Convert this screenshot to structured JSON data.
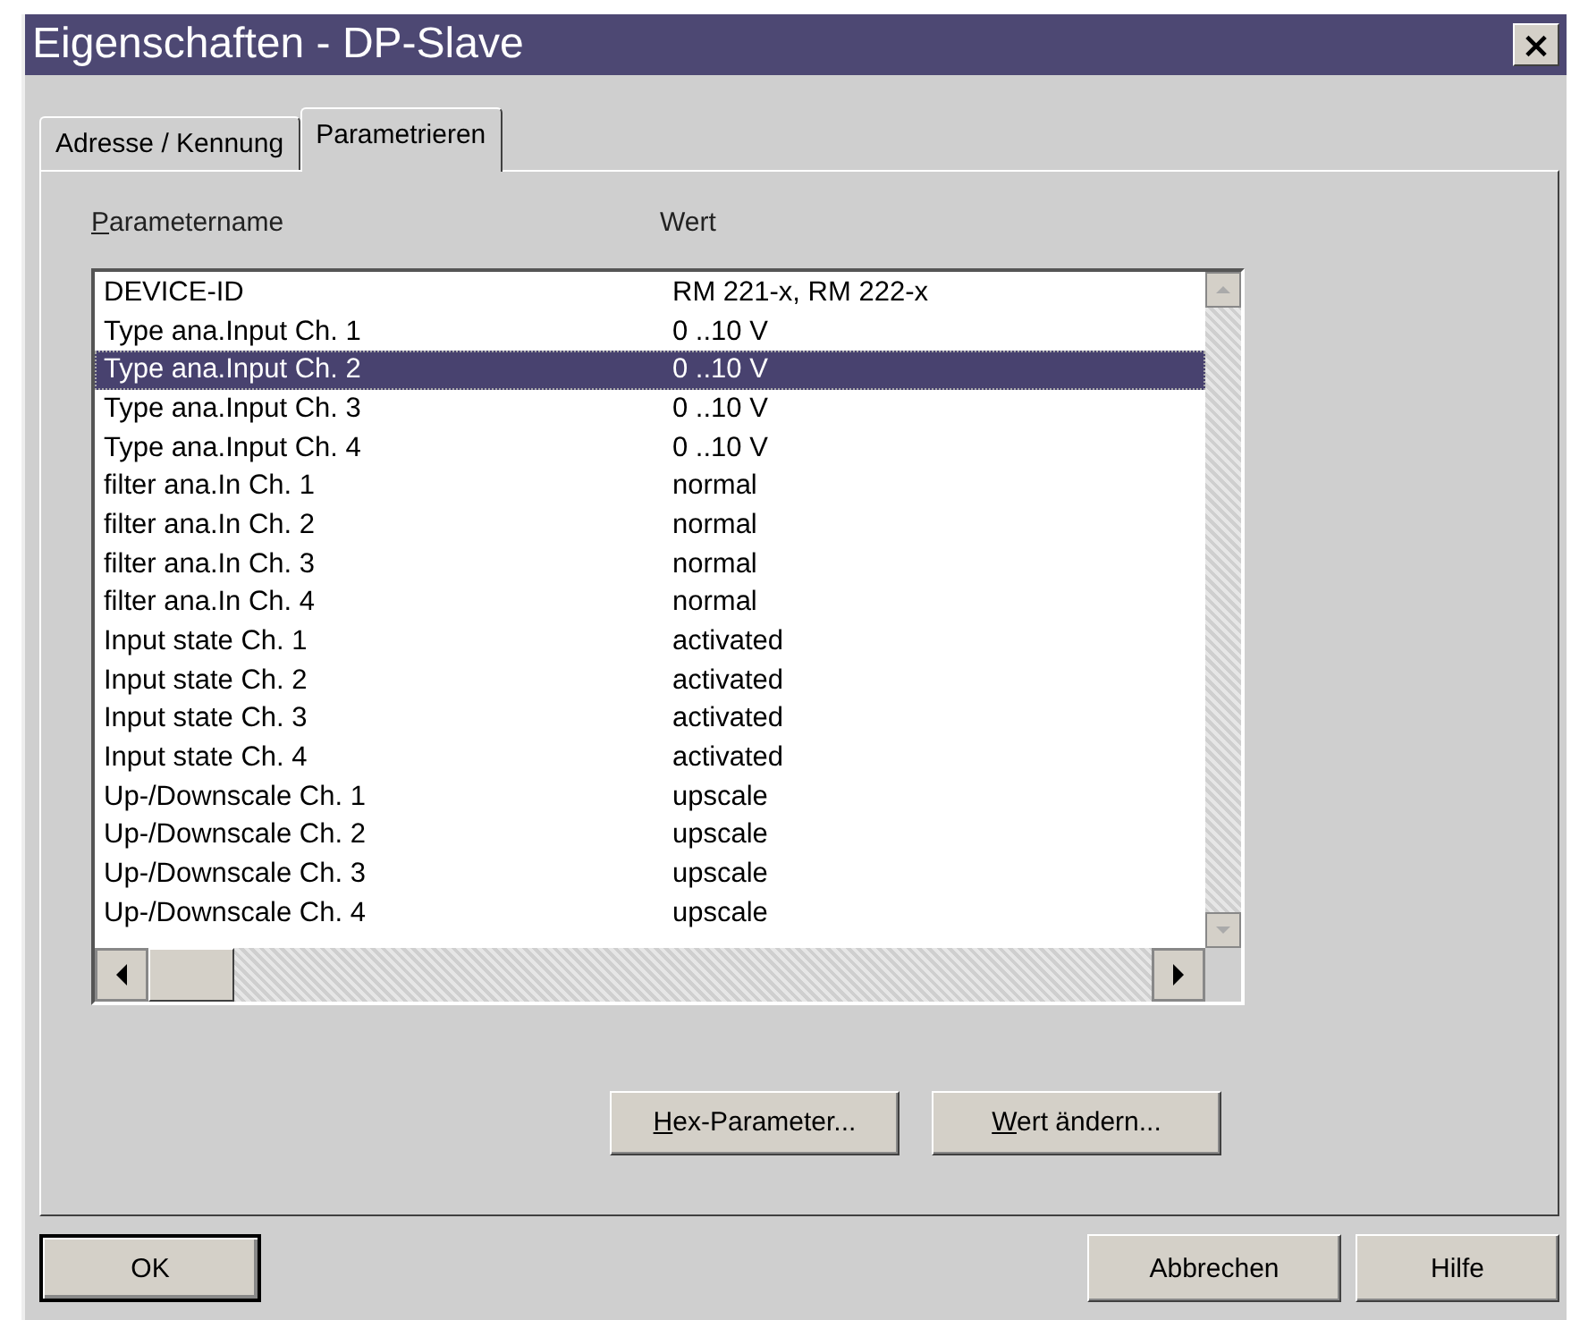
{
  "window": {
    "title": "Eigenschaften - DP-Slave",
    "close": "×"
  },
  "tabs": [
    {
      "label": "Adresse / Kennung",
      "selected": false
    },
    {
      "label": "Parametrieren",
      "selected": true
    }
  ],
  "list": {
    "columns": [
      "Parametername",
      "Wert"
    ],
    "rows": [
      {
        "name": "DEVICE-ID",
        "value": "RM 221-x, RM 222-x",
        "selected": false
      },
      {
        "name": "Type ana.Input Ch. 1",
        "value": "0 ..10 V",
        "selected": false
      },
      {
        "name": "Type ana.Input Ch. 2",
        "value": "0 ..10 V",
        "selected": true
      },
      {
        "name": "Type ana.Input Ch. 3",
        "value": "0 ..10 V",
        "selected": false
      },
      {
        "name": "Type ana.Input Ch. 4",
        "value": "0 ..10 V",
        "selected": false
      },
      {
        "name": "filter ana.In Ch. 1",
        "value": "normal",
        "selected": false
      },
      {
        "name": "filter ana.In Ch. 2",
        "value": "normal",
        "selected": false
      },
      {
        "name": "filter ana.In Ch. 3",
        "value": "normal",
        "selected": false
      },
      {
        "name": "filter ana.In Ch. 4",
        "value": "normal",
        "selected": false
      },
      {
        "name": "Input state Ch. 1",
        "value": "activated",
        "selected": false
      },
      {
        "name": "Input state Ch. 2",
        "value": "activated",
        "selected": false
      },
      {
        "name": "Input state Ch. 3",
        "value": "activated",
        "selected": false
      },
      {
        "name": "Input state Ch. 4",
        "value": "activated",
        "selected": false
      },
      {
        "name": "Up-/Downscale Ch. 1",
        "value": "upscale",
        "selected": false
      },
      {
        "name": "Up-/Downscale Ch. 2",
        "value": "upscale",
        "selected": false
      },
      {
        "name": "Up-/Downscale Ch. 3",
        "value": "upscale",
        "selected": false
      },
      {
        "name": "Up-/Downscale Ch. 4",
        "value": "upscale",
        "selected": false
      }
    ]
  },
  "panel_buttons": [
    "Hex-Parameter...",
    "Wert ändern..."
  ],
  "dialog_buttons": [
    {
      "label": "OK",
      "default": true
    },
    {
      "label": "Abbrechen",
      "default": false
    },
    {
      "label": "Hilfe",
      "default": false
    }
  ]
}
